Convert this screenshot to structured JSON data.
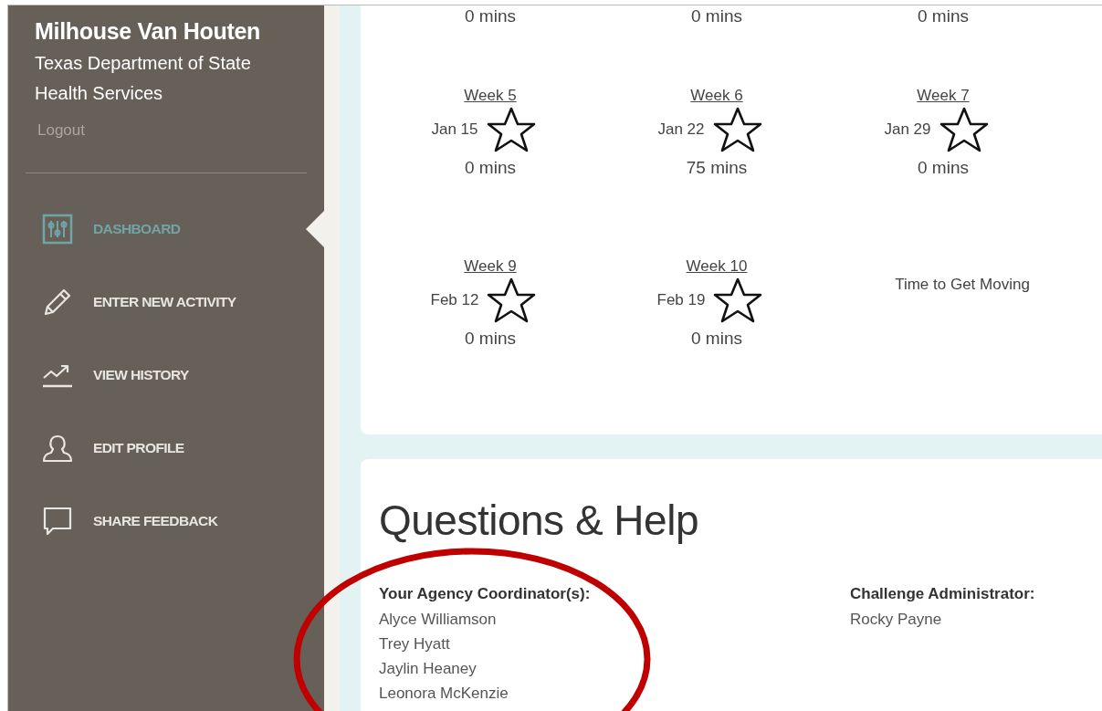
{
  "user": {
    "name": "Milhouse Van Houten",
    "organization": "Texas Department of State Health Services",
    "logout": "Logout"
  },
  "nav": [
    {
      "label": "DASHBOARD",
      "selected": true
    },
    {
      "label": "ENTER NEW ACTIVITY",
      "selected": false
    },
    {
      "label": "VIEW HISTORY",
      "selected": false
    },
    {
      "label": "EDIT PROFILE",
      "selected": false
    },
    {
      "label": "SHARE FEEDBACK",
      "selected": false
    }
  ],
  "weeks": [
    [
      {
        "kind": "week",
        "mins": "0 mins"
      },
      {
        "kind": "week",
        "mins": "0 mins"
      },
      {
        "kind": "week",
        "mins": "0 mins"
      }
    ],
    [
      {
        "kind": "week",
        "week": "Week 5",
        "date": "Jan 15",
        "mins": "0 mins"
      },
      {
        "kind": "week",
        "week": "Week 6",
        "date": "Jan 22",
        "mins": "75 mins"
      },
      {
        "kind": "week",
        "week": "Week 7",
        "date": "Jan 29",
        "mins": "0 mins"
      }
    ],
    [
      {
        "kind": "week",
        "week": "Week 9",
        "date": "Feb 12",
        "mins": "0 mins"
      },
      {
        "kind": "week",
        "week": "Week 10",
        "date": "Feb 19",
        "mins": "0 mins"
      },
      {
        "kind": "message",
        "text": "Time to Get Moving"
      }
    ]
  ],
  "help": {
    "title": "Questions & Help",
    "columns": [
      {
        "heading": "Your Agency Coordinator(s):",
        "names": [
          "Alyce Williamson",
          "Trey Hyatt",
          "Jaylin Heaney",
          "Leonora McKenzie"
        ]
      },
      {
        "heading": "Challenge Administrator:",
        "names": [
          "Rocky Payne"
        ]
      }
    ]
  },
  "annotation": {
    "kind": "ellipse"
  }
}
